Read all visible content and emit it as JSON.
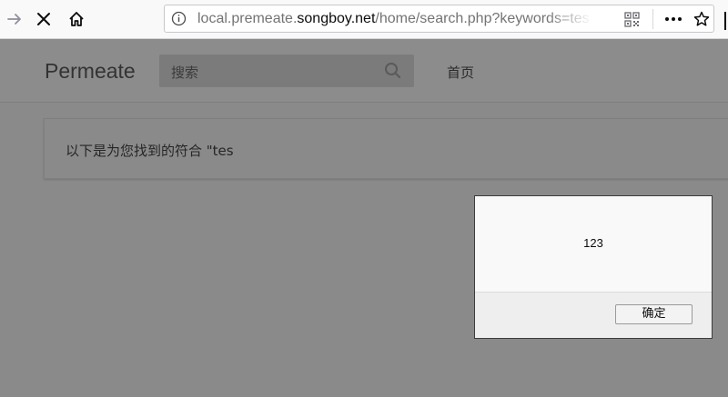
{
  "browser": {
    "url_prefix": "local.premeate.",
    "url_host": "songboy.net",
    "url_path": "/home/search.php?keywords=tes<"
  },
  "page": {
    "logo": "Permeate",
    "search_placeholder": "搜索",
    "nav_home": "首页",
    "result_text": "以下是为您找到的符合 \"tes"
  },
  "dialog": {
    "message": "123",
    "ok_label": "确定"
  }
}
